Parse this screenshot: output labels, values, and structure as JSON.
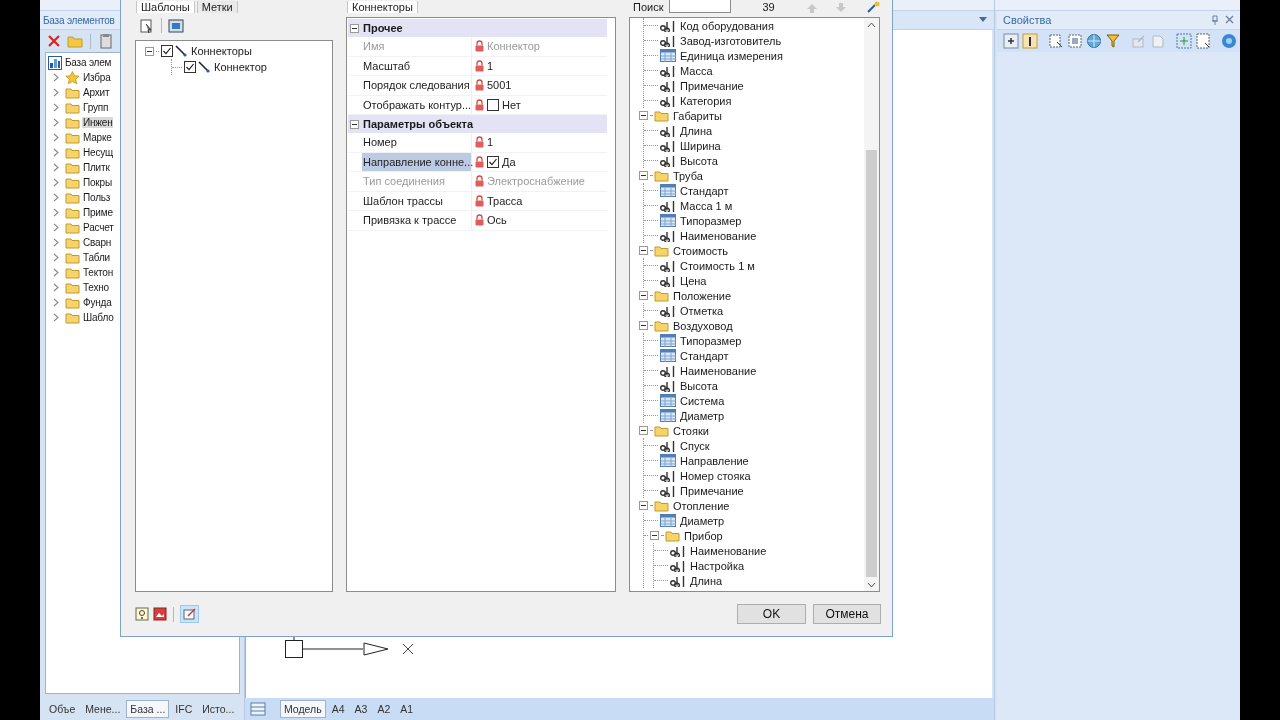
{
  "app": {
    "left_panel": {
      "title": "База элементов",
      "tree": [
        {
          "label": "База элем",
          "kind": "database",
          "selected": false
        },
        {
          "label": "Избра",
          "kind": "favorites",
          "expanded": false,
          "selected": false
        },
        {
          "label": "Архит",
          "kind": "folder",
          "expanded": false,
          "selected": false
        },
        {
          "label": "Групп",
          "kind": "folder",
          "expanded": false,
          "selected": false
        },
        {
          "label": "Инжен",
          "kind": "folder",
          "expanded": false,
          "selected": true
        },
        {
          "label": "Марке",
          "kind": "folder",
          "expanded": false,
          "selected": false
        },
        {
          "label": "Несущ",
          "kind": "folder",
          "expanded": false,
          "selected": false
        },
        {
          "label": "Плитк",
          "kind": "folder",
          "expanded": false,
          "selected": false
        },
        {
          "label": "Покры",
          "kind": "folder",
          "expanded": false,
          "selected": false
        },
        {
          "label": "Польз",
          "kind": "folder",
          "expanded": false,
          "selected": false
        },
        {
          "label": "Приме",
          "kind": "folder",
          "expanded": false,
          "selected": false
        },
        {
          "label": "Расчет",
          "kind": "folder",
          "expanded": false,
          "selected": false
        },
        {
          "label": "Сварн",
          "kind": "folder",
          "expanded": false,
          "selected": false
        },
        {
          "label": "Табли",
          "kind": "folder",
          "expanded": false,
          "selected": false
        },
        {
          "label": "Тектон",
          "kind": "folder",
          "expanded": false,
          "selected": false
        },
        {
          "label": "Техно",
          "kind": "folder",
          "expanded": false,
          "selected": false
        },
        {
          "label": "Фунда",
          "kind": "folder",
          "expanded": false,
          "selected": false
        },
        {
          "label": "Шабло",
          "kind": "folder",
          "expanded": false,
          "selected": false
        }
      ]
    },
    "left_tabs": [
      {
        "label": "Объе",
        "selected": false
      },
      {
        "label": "Мене...",
        "selected": false
      },
      {
        "label": "База ...",
        "selected": true
      },
      {
        "label": "IFC",
        "selected": false
      },
      {
        "label": "Исто...",
        "selected": false
      }
    ],
    "sheet_tabs": [
      {
        "label": "Модель",
        "selected": true
      },
      {
        "label": "A4",
        "selected": false
      },
      {
        "label": "A3",
        "selected": false
      },
      {
        "label": "A2",
        "selected": false
      },
      {
        "label": "A1",
        "selected": false
      }
    ],
    "properties_panel": {
      "title": "Свойства"
    }
  },
  "dialog": {
    "template_tabs": [
      {
        "label": "Шаблоны",
        "selected": true
      },
      {
        "label": "Метки",
        "selected": false
      }
    ],
    "template_tree": [
      {
        "label": "Коннекторы",
        "checked": true,
        "expanded": true,
        "children": [
          {
            "label": "Коннектор",
            "checked": true
          }
        ]
      }
    ],
    "property_tab": {
      "label": "Коннекторы",
      "selected": true
    },
    "property_grid": [
      {
        "category": "Прочее",
        "expanded": true,
        "rows": [
          {
            "name": "Имя",
            "value": "Коннектор",
            "kind": "text",
            "locked": true,
            "disabled": true,
            "selected": false
          },
          {
            "name": "Масштаб",
            "value": "1",
            "kind": "text",
            "locked": true,
            "disabled": false,
            "selected": false
          },
          {
            "name": "Порядок следования",
            "value": "5001",
            "kind": "text",
            "locked": true,
            "disabled": false,
            "selected": false
          },
          {
            "name": "Отображать контур...",
            "value": "Нет",
            "kind": "checkbox",
            "checked": false,
            "locked": true,
            "disabled": false,
            "selected": false
          }
        ]
      },
      {
        "category": "Параметры объекта",
        "expanded": true,
        "rows": [
          {
            "name": "Номер",
            "value": "1",
            "kind": "text",
            "locked": true,
            "disabled": false,
            "selected": false
          },
          {
            "name": "Направление конне...",
            "value": "Да",
            "kind": "checkbox",
            "checked": true,
            "locked": true,
            "disabled": false,
            "selected": true
          },
          {
            "name": "Тип соединения",
            "value": "Электроснабжение",
            "kind": "text",
            "locked": true,
            "disabled": true,
            "selected": false
          },
          {
            "name": "Шаблон трассы",
            "value": "Трасса",
            "kind": "text",
            "locked": true,
            "disabled": false,
            "selected": false
          },
          {
            "name": "Привязка к трассе",
            "value": "Ось",
            "kind": "text",
            "locked": true,
            "disabled": false,
            "selected": false
          }
        ]
      }
    ],
    "search": {
      "label": "Поиск",
      "count": "39"
    },
    "field_tree": {
      "cut_off_children": [
        {
          "label": "Код оборудования",
          "kind": "text"
        },
        {
          "label": "Завод-изготовитель",
          "kind": "text"
        },
        {
          "label": "Единица измерения",
          "kind": "list"
        },
        {
          "label": "Масса",
          "kind": "text"
        },
        {
          "label": "Примечание",
          "kind": "text"
        },
        {
          "label": "Категория",
          "kind": "text"
        }
      ],
      "nodes": [
        {
          "label": "Габариты",
          "kind": "folder",
          "expanded": true,
          "children": [
            {
              "label": "Длина",
              "kind": "text"
            },
            {
              "label": "Ширина",
              "kind": "text"
            },
            {
              "label": "Высота",
              "kind": "text"
            }
          ]
        },
        {
          "label": "Труба",
          "kind": "folder",
          "expanded": true,
          "children": [
            {
              "label": "Стандарт",
              "kind": "list"
            },
            {
              "label": "Масса 1 м",
              "kind": "text"
            },
            {
              "label": "Типоразмер",
              "kind": "list"
            },
            {
              "label": "Наименование",
              "kind": "text"
            }
          ]
        },
        {
          "label": "Стоимость",
          "kind": "folder",
          "expanded": true,
          "children": [
            {
              "label": "Стоимость 1 м",
              "kind": "text"
            },
            {
              "label": "Цена",
              "kind": "text"
            }
          ]
        },
        {
          "label": "Положение",
          "kind": "folder",
          "expanded": true,
          "children": [
            {
              "label": "Отметка",
              "kind": "text"
            }
          ]
        },
        {
          "label": "Воздуховод",
          "kind": "folder",
          "expanded": true,
          "children": [
            {
              "label": "Типоразмер",
              "kind": "list"
            },
            {
              "label": "Стандарт",
              "kind": "list"
            },
            {
              "label": "Наименование",
              "kind": "text"
            },
            {
              "label": "Высота",
              "kind": "text"
            },
            {
              "label": "Система",
              "kind": "list"
            },
            {
              "label": "Диаметр",
              "kind": "list"
            }
          ]
        },
        {
          "label": "Стояки",
          "kind": "folder",
          "expanded": true,
          "children": [
            {
              "label": "Спуск",
              "kind": "text"
            },
            {
              "label": "Направление",
              "kind": "list"
            },
            {
              "label": "Номер стояка",
              "kind": "text"
            },
            {
              "label": "Примечание",
              "kind": "text"
            }
          ]
        },
        {
          "label": "Отопление",
          "kind": "folder",
          "expanded": true,
          "children": [
            {
              "label": "Диаметр",
              "kind": "list"
            },
            {
              "label": "Прибор",
              "kind": "folder",
              "expanded": true,
              "children": [
                {
                  "label": "Наименование",
                  "kind": "text"
                },
                {
                  "label": "Настройка",
                  "kind": "text"
                },
                {
                  "label": "Длина",
                  "kind": "text"
                }
              ]
            }
          ]
        }
      ]
    },
    "buttons": [
      {
        "label": "OK"
      },
      {
        "label": "Отмена"
      }
    ]
  }
}
